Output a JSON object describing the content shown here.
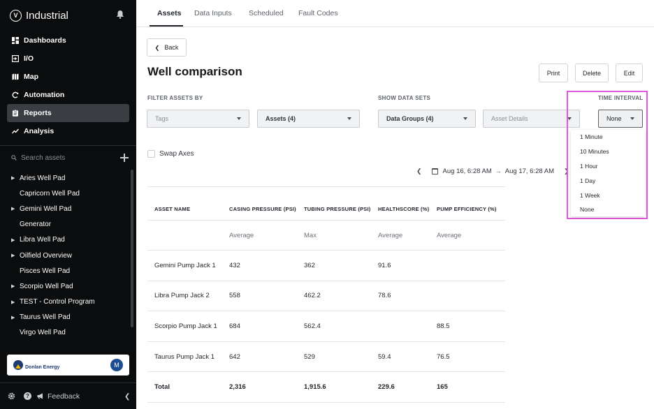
{
  "app": {
    "brand": "Industrial",
    "logo_glyph": "V",
    "nav": [
      {
        "label": "Dashboards",
        "icon": "grid-icon",
        "active": false
      },
      {
        "label": "I/O",
        "icon": "io-icon",
        "active": false
      },
      {
        "label": "Map",
        "icon": "map-icon",
        "active": false
      },
      {
        "label": "Automation",
        "icon": "automation-icon",
        "active": false
      },
      {
        "label": "Reports",
        "icon": "clipboard-icon",
        "active": true
      },
      {
        "label": "Analysis",
        "icon": "chart-line-icon",
        "active": false
      }
    ],
    "search": {
      "placeholder": "Search assets"
    },
    "tree": [
      {
        "label": "Aries Well Pad",
        "expandable": true
      },
      {
        "label": "Capricorn Well Pad",
        "expandable": false
      },
      {
        "label": "Gemini Well Pad",
        "expandable": true
      },
      {
        "label": "Generator",
        "expandable": false
      },
      {
        "label": "Libra Well Pad",
        "expandable": true
      },
      {
        "label": "Oilfield Overview",
        "expandable": true
      },
      {
        "label": "Pisces Well Pad",
        "expandable": false
      },
      {
        "label": "Scorpio Well Pad",
        "expandable": true
      },
      {
        "label": "TEST - Control Program",
        "expandable": true
      },
      {
        "label": "Taurus Well Pad",
        "expandable": true
      },
      {
        "label": "Virgo Well Pad",
        "expandable": false
      }
    ],
    "org": {
      "name": "Donlan Energy",
      "avatar": "M"
    },
    "footer": {
      "feedback": "Feedback"
    }
  },
  "tabs": [
    "Assets",
    "Data Inputs",
    "Scheduled",
    "Fault Codes"
  ],
  "page": {
    "back": "Back",
    "title": "Well comparison",
    "actions": {
      "print": "Print",
      "delete": "Delete",
      "edit": "Edit"
    }
  },
  "filters": {
    "filter_label": "FILTER ASSETS BY",
    "datasets_label": "SHOW DATA SETS",
    "interval_label": "TIME INTERVAL",
    "tags_placeholder": "Tags",
    "assets_value": "Assets (4)",
    "data_groups_value": "Data Groups (4)",
    "asset_details_placeholder": "Asset Details",
    "interval_value": "None"
  },
  "interval_options": [
    "1 Minute",
    "10 Minutes",
    "1 Hour",
    "1 Day",
    "1 Week",
    "None"
  ],
  "swap_axes": "Swap Axes",
  "date_range": {
    "start": "Aug 16, 6:28 AM",
    "end": "Aug 17, 6:28 AM"
  },
  "table": {
    "headers": [
      "ASSET NAME",
      "CASING PRESSURE (PSI)",
      "TUBING PRESSURE (PSI)",
      "HEALTHSCORE (%)",
      "PUMP EFFICIENCY (%)"
    ],
    "aggregations": [
      "",
      "Average",
      "Max",
      "Average",
      "Average"
    ],
    "rows": [
      [
        "Gemini Pump Jack 1",
        "432",
        "362",
        "91.6",
        ""
      ],
      [
        "Libra Pump Jack 2",
        "558",
        "462.2",
        "78.6",
        ""
      ],
      [
        "Scorpio Pump Jack 1",
        "684",
        "562.4",
        "",
        "88.5"
      ],
      [
        "Taurus Pump Jack 1",
        "642",
        "529",
        "59.4",
        "76.5"
      ]
    ],
    "total": [
      "Total",
      "2,316",
      "1,915.6",
      "229.6",
      "165"
    ]
  }
}
